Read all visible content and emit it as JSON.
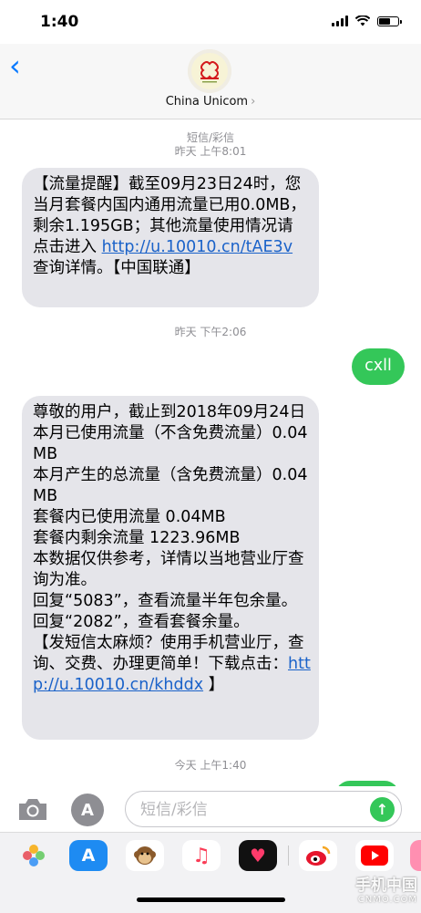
{
  "status": {
    "time": "1:40"
  },
  "nav": {
    "contact_name": "China Unicom",
    "avatar_text": "China Unicom"
  },
  "thread": [
    {
      "type": "stamp",
      "line1": "短信/彩信",
      "line2": "昨天 上午8:01"
    },
    {
      "type": "incoming",
      "text_before": "【流量提醒】截至09月23日24时，您当月套餐内国内通用流量已用0.0MB，剩余1.195GB；其他流量使用情况请点击进入 ",
      "link": "http://u.10010.cn/tAE3v",
      "text_after": " 查询详情。【中国联通】"
    },
    {
      "type": "stamp",
      "line1": "昨天 下午2:06"
    },
    {
      "type": "outgoing",
      "text": "cxll"
    },
    {
      "type": "incoming",
      "lines": [
        "尊敬的用户，截止到2018年09月24日",
        " 本月已使用流量（不含免费流量）0.04MB",
        " 本月产生的总流量（含免费流量）0.04MB",
        " 套餐内已使用流量 0.04MB",
        " 套餐内剩余流量 1223.96MB",
        " 本数据仅供参考，详情以当地营业厅查询为准。",
        " 回复“5083”，查看流量半年包余量。",
        " 回复“2082”，查看套餐余量。",
        " 【发短信太麻烦？使用手机营业厅，查询、交费、办理更简单！下载点击："
      ],
      "link": "http://u.10010.cn/khddx",
      "text_after": " 】"
    },
    {
      "type": "stamp",
      "line1": "今天 上午1:40"
    }
  ],
  "composer": {
    "placeholder": "短信/彩信",
    "send_icon": "arrow-up-icon",
    "camera_icon": "camera-icon",
    "apps_icon": "app-store-icon"
  },
  "drawer": {
    "apps": [
      {
        "name": "photos-app-icon",
        "glyph": "✿",
        "bg": "#ffffff",
        "fg": "#e8454f"
      },
      {
        "name": "app-store-app-icon",
        "glyph": "A",
        "bg": "#1e8bf2",
        "fg": "#ffffff"
      },
      {
        "name": "animoji-app-icon",
        "glyph": "🐵",
        "bg": "#ffffff",
        "fg": "#8a5a2b"
      },
      {
        "name": "music-app-icon",
        "glyph": "♫",
        "bg": "#ffffff",
        "fg": "#fa3c56"
      },
      {
        "name": "digital-touch-app-icon",
        "glyph": "♥",
        "bg": "#111111",
        "fg": "#ff3b6b"
      },
      {
        "name": "weibo-app-icon",
        "glyph": "◉",
        "bg": "#ffffff",
        "fg": "#e6162d"
      },
      {
        "name": "youtube-app-icon",
        "glyph": "▶",
        "bg": "#ffffff",
        "fg": "#ff0000"
      }
    ]
  },
  "watermark": {
    "line1": "手机中国",
    "line2": "CNMO.COM"
  },
  "colors": {
    "imessage_blue": "#0a7aff",
    "sms_green": "#34c759",
    "bubble_gray": "#e5e5ea",
    "stamp_gray": "#8e8e93"
  }
}
